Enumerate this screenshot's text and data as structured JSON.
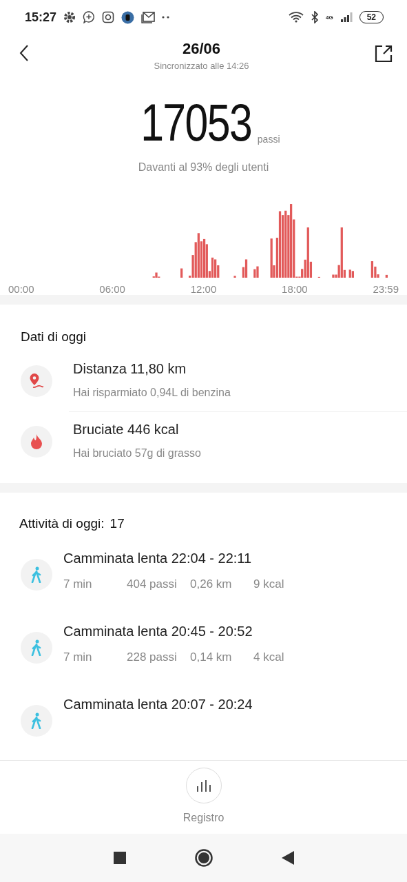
{
  "status_bar": {
    "time": "15:27",
    "network": "4G",
    "battery": "52"
  },
  "header": {
    "title": "26/06",
    "subtitle": "Sincronizzato alle 14:26"
  },
  "steps": {
    "value": "17053",
    "unit": "passi",
    "rank": "Davanti al 93% degli utenti"
  },
  "chart": {
    "time_labels": [
      "00:00",
      "06:00",
      "12:00",
      "18:00",
      "23:59"
    ]
  },
  "today": {
    "title": "Dati di oggi",
    "items": [
      {
        "kind": "distance",
        "label": "Distanza 11,80 km",
        "detail": "Hai risparmiato 0,94L di benzina"
      },
      {
        "kind": "calories",
        "label": "Bruciate 446 kcal",
        "detail": "Hai bruciato 57g di grasso"
      }
    ]
  },
  "activities": {
    "title": "Attività di oggi:",
    "count": "17",
    "items": [
      {
        "title": "Camminata lenta 22:04 - 22:11",
        "stats": [
          "7 min",
          "404 passi",
          "0,26 km",
          "9 kcal"
        ]
      },
      {
        "title": "Camminata lenta 20:45 - 20:52",
        "stats": [
          "7 min",
          "228 passi",
          "0,14 km",
          "4 kcal"
        ]
      },
      {
        "title": "Camminata lenta 20:07 - 20:24"
      }
    ]
  },
  "bottom_tab": {
    "label": "Registro"
  }
}
